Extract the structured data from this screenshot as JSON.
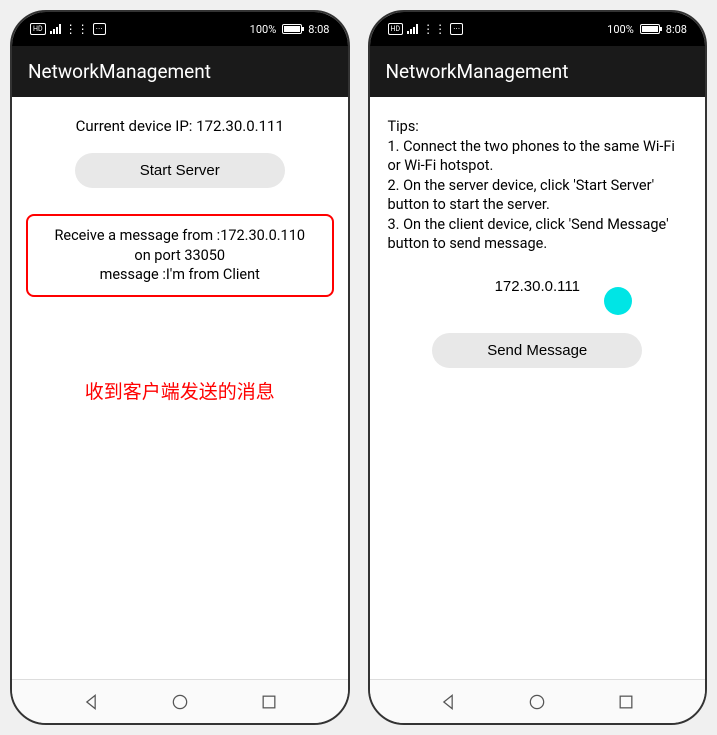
{
  "status": {
    "battery_pct": "100%",
    "time": "8:08"
  },
  "header": {
    "title": "NetworkManagement"
  },
  "server": {
    "device_ip_label": "Current device IP: 172.30.0.111",
    "start_button": "Start Server",
    "msg_line1": "Receive a message from :172.30.0.110",
    "msg_line2": "on port 33050",
    "msg_line3": "message :I'm from Client",
    "chinese_note": "收到客户端发送的消息"
  },
  "client": {
    "tips_title": "Tips:",
    "tip1": " 1. Connect the two phones to the same Wi-Fi or Wi-Fi hotspot.",
    "tip2": " 2. On the server device, click 'Start Server' button to start the server.",
    "tip3": " 3. On the client device, click 'Send Message' button to send message.",
    "ip_value": "172.30.0.111",
    "send_button": "Send Message"
  }
}
